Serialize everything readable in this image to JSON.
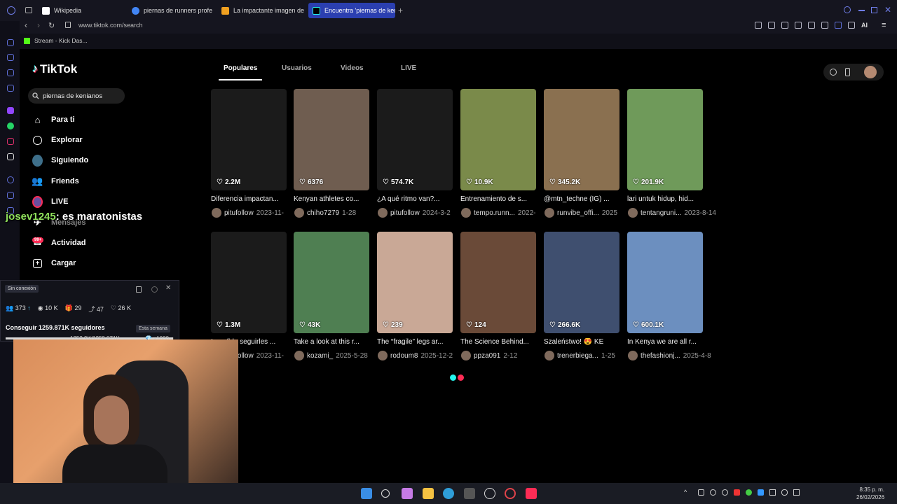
{
  "browser": {
    "tabs": [
      {
        "label": "Wikipedia",
        "favicon": "wikipedia-icon",
        "active": false
      },
      {
        "label": "piernas de runners profe",
        "favicon": "google-icon",
        "active": false
      },
      {
        "label": "La impactante imagen de",
        "favicon": "bookmark-icon",
        "active": false
      },
      {
        "label": "Encuentra 'piernas de ken",
        "favicon": "tiktok-icon",
        "active": true
      }
    ],
    "url": "www.tiktok.com/search",
    "bookmark": "Stream - Kick Das...",
    "ai_label": "AI"
  },
  "tiktok": {
    "logo": "TikTok",
    "search_value": "piernas de kenianos",
    "nav": [
      {
        "label": "Para ti",
        "icon": "home-icon"
      },
      {
        "label": "Explorar",
        "icon": "compass-icon"
      },
      {
        "label": "Siguiendo",
        "icon": "following-avatar-icon"
      },
      {
        "label": "Friends",
        "icon": "friends-icon"
      },
      {
        "label": "LIVE",
        "icon": "live-icon"
      },
      {
        "label": "Mensajes",
        "icon": "message-icon"
      },
      {
        "label": "Actividad",
        "icon": "activity-icon"
      },
      {
        "label": "Cargar",
        "icon": "upload-icon"
      }
    ],
    "activity_badge": "99+",
    "tabs": [
      "Populares",
      "Usuarios",
      "Videos",
      "LIVE"
    ],
    "active_tab": "Populares",
    "videos": [
      {
        "likes": "2.2M",
        "caption": "Diferencia impactan...",
        "author": "pitufollow",
        "date": "2023-11-",
        "thumb": "#1b1b1b"
      },
      {
        "likes": "6376",
        "caption": "Kenyan athletes co...",
        "author": "chiho7279",
        "date": "1-28",
        "thumb": "#6f5d50"
      },
      {
        "likes": "574.7K",
        "caption": "¿A qué ritmo van?...",
        "author": "pitufollow",
        "date": "2024-3-2",
        "thumb": "#1b1b1b"
      },
      {
        "likes": "10.9K",
        "caption": "Entrenamiento de s...",
        "author": "tempo.runn...",
        "date": "2022-",
        "thumb": "#7a8a4a"
      },
      {
        "likes": "345.2K",
        "caption": "@mtn_techne (IG) ...",
        "author": "runvibe_offi...",
        "date": "2025",
        "thumb": "#8a7050"
      },
      {
        "likes": "201.9K",
        "caption": "lari untuk hidup, hid...",
        "author": "tentangruni...",
        "date": "2023-8-14",
        "thumb": "#6f9a5a"
      },
      {
        "likes": "1.3M",
        "caption": "Increíble seguirles ...",
        "author": "pitufollow",
        "date": "2023-11-",
        "thumb": "#1b1b1b"
      },
      {
        "likes": "43K",
        "caption": "Take a look at this r...",
        "author": "kozami_",
        "date": "2025-5-28",
        "thumb": "#4f7f52"
      },
      {
        "likes": "239",
        "caption": "The “fragile” legs ar...",
        "author": "rodoum8",
        "date": "2025-12-2",
        "thumb": "#c9a896"
      },
      {
        "likes": "124",
        "caption": "The Science Behind...",
        "author": "ppza091",
        "date": "2-12",
        "thumb": "#6a4a38"
      },
      {
        "likes": "266.6K",
        "caption": "Szaleństwo! 😍 KE",
        "author": "trenerbiega...",
        "date": "1-25",
        "thumb": "#3f4f6f"
      },
      {
        "likes": "600.1K",
        "caption": "In Kenya we are all r...",
        "author": "thefashionj...",
        "date": "2025-4-8",
        "thumb": "#6c8fbf"
      }
    ]
  },
  "overlay": {
    "chat_user": "josev1245",
    "chat_text": ": es maratonistas",
    "status": "Sin conexión",
    "stats": [
      {
        "icon": "viewers-icon",
        "value": "373"
      },
      {
        "icon": "eye-icon",
        "value": "10 K"
      },
      {
        "icon": "gift-icon",
        "value": "29"
      },
      {
        "icon": "share-icon",
        "value": "47"
      },
      {
        "icon": "heart-icon",
        "value": "26 K"
      }
    ],
    "goal": "Conseguir 1259.871K seguidores",
    "goal_period": "Esta semana",
    "goal_progress_text": "1253.9K/1259.871K",
    "goal_bonus": "x1000",
    "goal_fraction": 0.995
  },
  "taskbar": {
    "time": "8:35 p. m.",
    "date": "26/02/2026"
  }
}
